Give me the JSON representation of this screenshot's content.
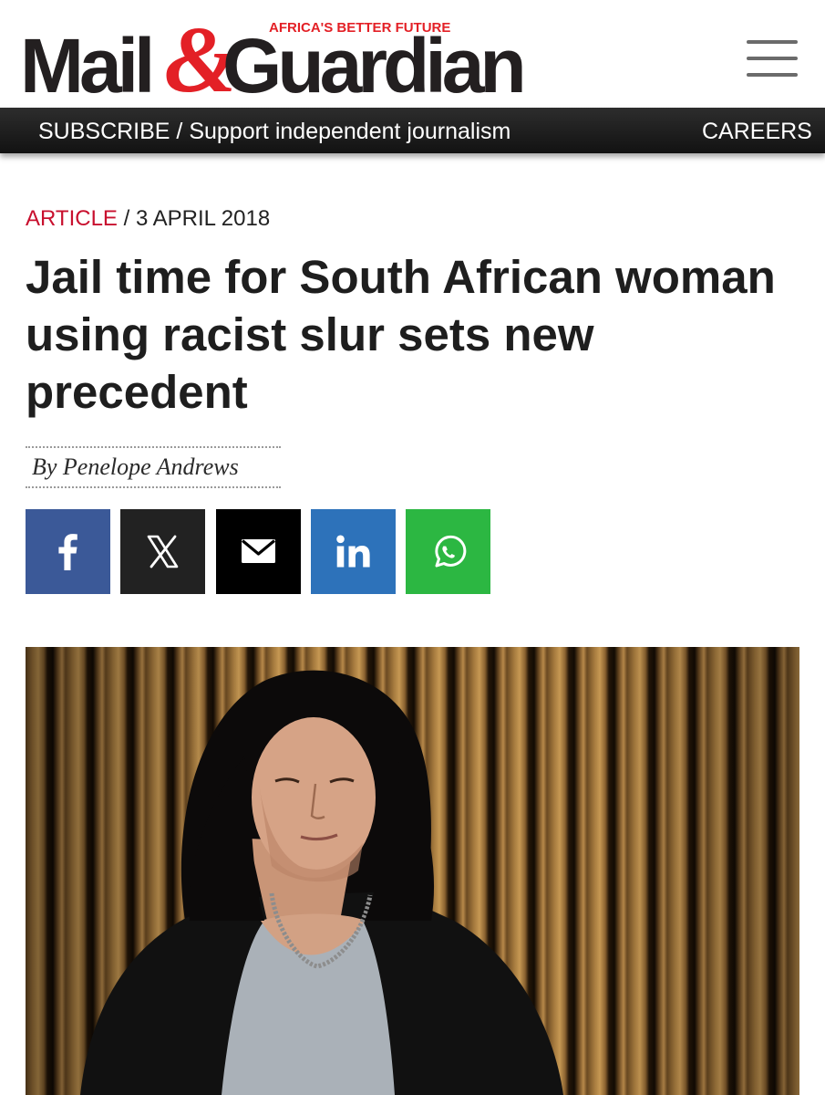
{
  "header": {
    "logo_mail": "Mail",
    "logo_amp": "&",
    "logo_guardian": "Guardian",
    "tagline": "AFRICA'S BETTER FUTURE",
    "menu_icon": "hamburger-menu-icon"
  },
  "subscribe_bar": {
    "subscribe_text": "SUBSCRIBE / Support independent journalism",
    "careers_text": "CAREERS"
  },
  "article": {
    "category": "ARTICLE",
    "separator": "/",
    "date": "3 APRIL 2018",
    "headline": "Jail time for South African woman using racist slur sets new precedent",
    "byline": "By Penelope Andrews"
  },
  "share_buttons": [
    {
      "network": "facebook",
      "icon": "facebook-icon",
      "color": "#3b5998"
    },
    {
      "network": "x",
      "icon": "x-icon",
      "color": "#222222"
    },
    {
      "network": "email",
      "icon": "envelope-icon",
      "color": "#000000"
    },
    {
      "network": "linkedin",
      "icon": "linkedin-icon",
      "color": "#2d72ba"
    },
    {
      "network": "whatsapp",
      "icon": "whatsapp-icon",
      "color": "#2cb742"
    }
  ],
  "colors": {
    "brand_red": "#e32026",
    "category_red": "#c8102e",
    "bar_dark": "#1a1a1a",
    "headline": "#1e1e1e"
  }
}
